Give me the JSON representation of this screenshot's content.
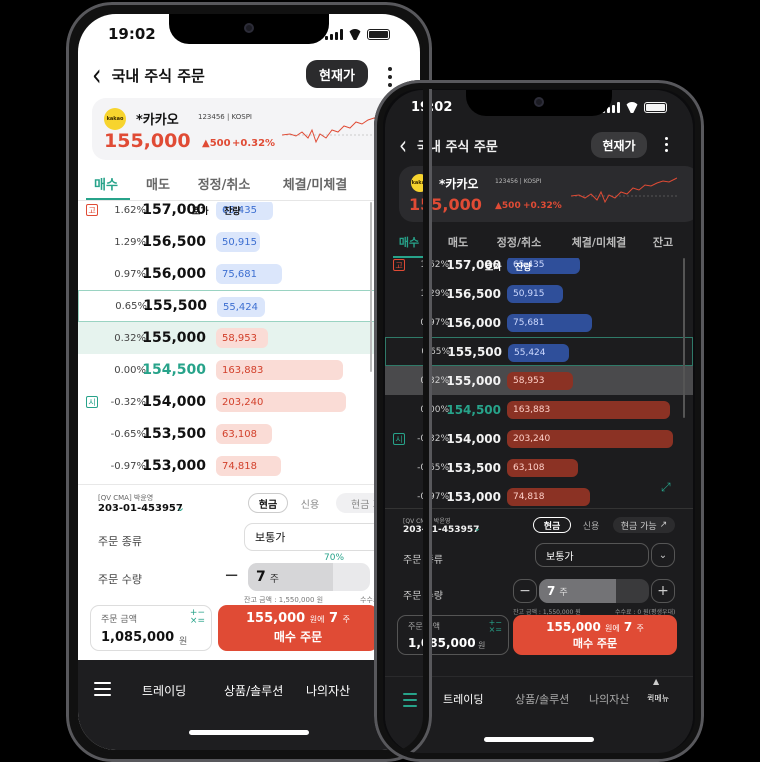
{
  "status": {
    "time": "19:02"
  },
  "header": {
    "back_icon": "chevron-left-icon",
    "title": "국내 주식 주문",
    "current_price_button": "현재가",
    "more_icon": "kebab-icon"
  },
  "stock": {
    "logo_text": "kakao",
    "name": "*카카오",
    "code": "123456 | KOSPI",
    "price": "155,000",
    "change": "▲500",
    "change_pct": "+0.32%"
  },
  "tabs": [
    "매수",
    "매도",
    "정정/취소",
    "체결/미체결",
    "잔고"
  ],
  "orderbook": {
    "header_price": "호가",
    "header_volume": "잔량",
    "rows": [
      {
        "pct": "1.62%",
        "price": "157,000",
        "volume": "65,435",
        "side": "ask",
        "level": 0.44,
        "mark": "고"
      },
      {
        "pct": "1.29%",
        "price": "156,500",
        "volume": "50,915",
        "side": "ask",
        "level": 0.34
      },
      {
        "pct": "0.97%",
        "price": "156,000",
        "volume": "75,681",
        "side": "ask",
        "level": 0.51
      },
      {
        "pct": "0.65%",
        "price": "155,500",
        "volume": "55,424",
        "side": "ask",
        "level": 0.37
      },
      {
        "pct": "0.32%",
        "price": "155,000",
        "volume": "58,953",
        "side": "bid",
        "level": 0.4
      },
      {
        "pct": "0.00%",
        "price": "154,500",
        "volume": "163,883",
        "side": "bid",
        "level": 0.98
      },
      {
        "pct": "-0.32%",
        "price": "154,000",
        "volume": "203,240",
        "side": "bid",
        "level": 1.0,
        "mark": "시"
      },
      {
        "pct": "-0.65%",
        "price": "153,500",
        "volume": "63,108",
        "side": "bid",
        "level": 0.43
      },
      {
        "pct": "-0.97%",
        "price": "153,000",
        "volume": "74,818",
        "side": "bid",
        "level": 0.5
      }
    ]
  },
  "order": {
    "account_label": "[QV CMA] 박윤영",
    "account_number": "203-01-453957",
    "chip_cash": "현금",
    "chip_credit": "신용",
    "chip_available": "현금 가능",
    "type_label": "주문 종류",
    "type_value": "보통가",
    "ratio": "70%",
    "qty_label": "주문 수량",
    "qty_value": "7",
    "qty_unit": "주",
    "qty_fill": 0.7,
    "minus": "−",
    "plus": "+",
    "balance_note": "잔고 금액 : 1,550,000 원",
    "fee_note": "수수료 : 0 원",
    "fee_note_dark": "수수료 : 0 원(평생우대)",
    "amount_label": "주문 금액",
    "amount_value": "1,085,000",
    "amount_unit": "원",
    "buy_price": "155,000",
    "buy_mid": "원에",
    "buy_qty": "7",
    "buy_unit": "주",
    "buy_button": "매수 주문"
  },
  "nav": {
    "menu_icon": "hamburger-icon",
    "items": [
      "트레이딩",
      "상품/솔루션",
      "나의자산"
    ],
    "quick_menu": "퀵메뉴"
  },
  "colors": {
    "accent": "#27a38a",
    "up": "#e04b35",
    "down_blue": "#3d6fd1",
    "light_bg": "#ffffff",
    "dark_bg": "#1c1c1e"
  }
}
